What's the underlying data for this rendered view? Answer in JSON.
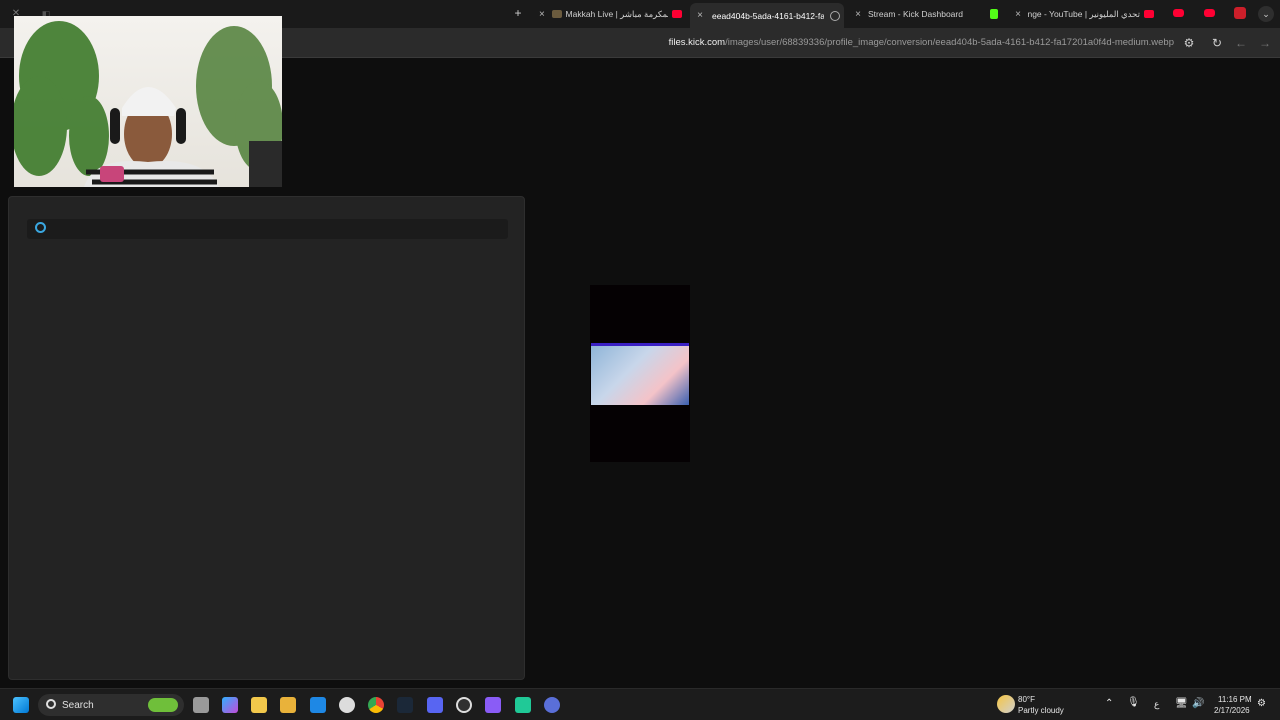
{
  "browser": {
    "tabs": [
      {
        "label": "Makkah Live | قناة مكة المكرمة مباشر",
        "active": false
      },
      {
        "label": "eead404b-5ada-4161-b412-fa1",
        "active": true
      },
      {
        "label": "Stream - Kick Dashboard",
        "active": false
      },
      {
        "label": "تحدي المليونير | Challenge - YouTube",
        "active": false
      }
    ],
    "url_domain": "files.kick.com",
    "url_path": "/images/user/68839336/profile_image/conversion/eead404b-5ada-4161-b412-fa17201a0f4d-medium.webp"
  },
  "taskbar": {
    "search_label": "Search",
    "weather_temp": "80°F",
    "weather_desc": "Partly cloudy",
    "time": "11:16 PM",
    "date": "2/17/2026",
    "lang": "ع"
  },
  "colors": {
    "accent": "#53fc18",
    "youtube": "#ff0033",
    "active_tab": "#2b2b2b"
  }
}
